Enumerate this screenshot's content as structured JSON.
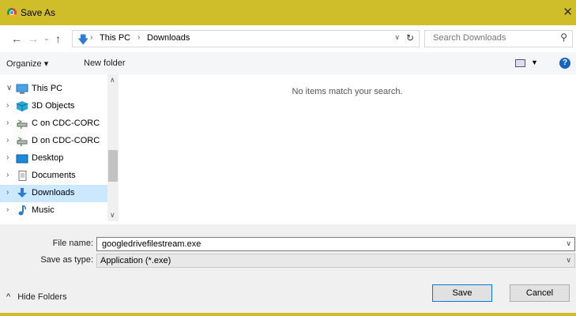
{
  "window": {
    "title": "Save As",
    "close_glyph": "✕",
    "accent": "#cfbd2a"
  },
  "nav": {
    "back_glyph": "←",
    "forward_glyph": "→",
    "recent_glyph": "⌄",
    "up_glyph": "↑",
    "breadcrumbs": [
      "This PC",
      "Downloads"
    ],
    "crumb_sep": "›",
    "search_placeholder": "Search Downloads"
  },
  "toolbar": {
    "organize": "Organize ▾",
    "new_folder": "New folder",
    "help": "?"
  },
  "tree": {
    "items": [
      {
        "label": "This PC",
        "expander": "∨",
        "icon": "monitor-icon"
      },
      {
        "label": "3D Objects",
        "expander": "›",
        "icon": "cube-icon"
      },
      {
        "label": "C on CDC-CORC",
        "expander": "›",
        "icon": "network-drive-icon"
      },
      {
        "label": "D on CDC-CORC",
        "expander": "›",
        "icon": "network-drive-icon"
      },
      {
        "label": "Desktop",
        "expander": "›",
        "icon": "desktop-icon"
      },
      {
        "label": "Documents",
        "expander": "›",
        "icon": "document-icon"
      },
      {
        "label": "Downloads",
        "expander": "›",
        "icon": "download-arrow-icon",
        "selected": true
      },
      {
        "label": "Music",
        "expander": "›",
        "icon": "music-note-icon"
      }
    ]
  },
  "content": {
    "empty_message": "No items match your search."
  },
  "form": {
    "file_name_label": "File name:",
    "file_name_value": "googledrivefilestream.exe",
    "save_type_label": "Save as type:",
    "save_type_value": "Application (*.exe)"
  },
  "footer": {
    "hide_folders": "Hide Folders",
    "hide_glyph": "^",
    "save": "Save",
    "cancel": "Cancel"
  }
}
